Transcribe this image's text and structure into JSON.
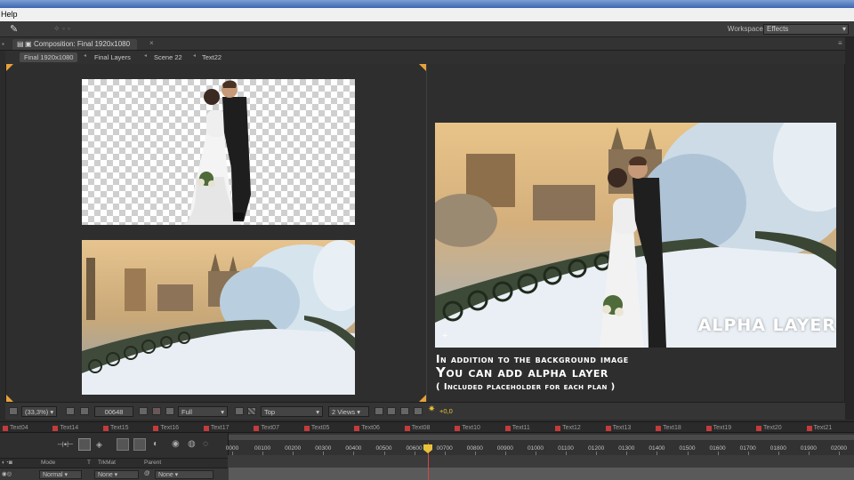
{
  "menubar": {
    "help_label": "Help"
  },
  "workspace": {
    "label": "Workspace:",
    "value": "Effects"
  },
  "composition": {
    "tab_label": "Composition: Final 1920x1080"
  },
  "breadcrumbs": [
    "Final 1920x1080",
    "Final Layers",
    "Scene 22",
    "Text22"
  ],
  "preview": {
    "alpha_label": "ALPHA LAYER",
    "caption_line1": "In addition to the background image",
    "caption_line2": "You can add alpha layer",
    "caption_line3": "(   Included placeholder for each plan   )"
  },
  "viewer_bar": {
    "zoom": "(33,3%)",
    "timecode": "00648",
    "resolution": "Full",
    "view": "Top",
    "views": "2 Views",
    "exposure": "+0,0"
  },
  "timeline_tabs": [
    "Text04",
    "Text14",
    "Text15",
    "Text16",
    "Text17",
    "Text07",
    "Text05",
    "Text06",
    "Text08",
    "Text10",
    "Text11",
    "Text12",
    "Text13",
    "Text18",
    "Text19",
    "Text20",
    "Text21"
  ],
  "ruler": {
    "ticks": [
      "0000",
      "00100",
      "00200",
      "00300",
      "00400",
      "00500",
      "00600",
      "00700",
      "00800",
      "00900",
      "01000",
      "01100",
      "01200",
      "01300",
      "01400",
      "01500",
      "01600",
      "01700",
      "01800",
      "01900",
      "02000"
    ]
  },
  "columns": {
    "mode": "Mode",
    "t": "T",
    "trkmat": "TrkMat",
    "parent": "Parent"
  },
  "layer": {
    "mode": "Normal",
    "trkmat": "None",
    "parent": "None"
  },
  "colors": {
    "accent_red": "#c43b3b",
    "playhead": "#d44444",
    "panel": "#2b2b2b",
    "gold": "#e8a23a"
  }
}
